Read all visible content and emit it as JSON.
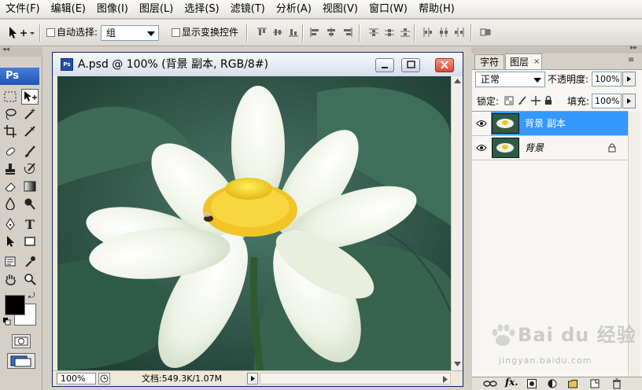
{
  "menu": [
    "文件(F)",
    "编辑(E)",
    "图像(I)",
    "图层(L)",
    "选择(S)",
    "滤镜(T)",
    "分析(A)",
    "视图(V)",
    "窗口(W)",
    "帮助(H)"
  ],
  "options": {
    "auto_select_label": "自动选择:",
    "auto_select_value": "组",
    "show_transform_label": "显示变换控件"
  },
  "tools": {
    "ps_logo": "Ps"
  },
  "document": {
    "title": "A.psd @ 100% (背景 副本, RGB/8#)",
    "zoom": "100%",
    "doc_info": "文档:549.3K/1.07M"
  },
  "layers_panel": {
    "tabs": [
      "字符",
      "图层"
    ],
    "blend_mode": "正常",
    "opacity_label": "不透明度:",
    "opacity_value": "100%",
    "lock_label": "锁定:",
    "fill_label": "填充:",
    "fill_value": "100%",
    "layers": [
      {
        "name": "背景 副本",
        "selected": true,
        "locked": false
      },
      {
        "name": "背景",
        "selected": false,
        "locked": true
      }
    ]
  },
  "watermark": {
    "brand": "Bai du 经验",
    "url": "jingyan.baidu.com"
  },
  "colors": {
    "accent": "#3399ff",
    "close_red": "#d9472e",
    "leaf_green": "#2f5a4a"
  }
}
